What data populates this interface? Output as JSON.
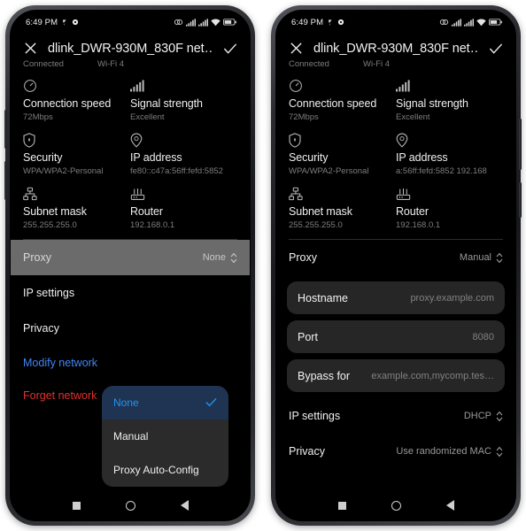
{
  "colors": {
    "screen_bg": "#000000",
    "accent_blue": "#4285f4",
    "link_red": "#e0322c",
    "dropdown_selected_bg": "#1f3352",
    "dropdown_selected_text": "#2196f3",
    "field_bg": "#262626",
    "pressed_row_bg": "#6b6b6b",
    "label_text": "#f0f0f0",
    "muted_text": "#7d7d7d"
  },
  "statusbar": {
    "time": "6:49 PM",
    "left_icons": [
      "location-off-icon",
      "gear-icon"
    ],
    "right_icons": [
      "data-saver-icon",
      "signal-bars-sim1-icon",
      "signal-bars-sim2-icon",
      "wifi-icon",
      "battery-icon"
    ]
  },
  "header": {
    "close_icon": "close-icon",
    "title": "dlink_DWR-930M_830F net…",
    "confirm_icon": "check-icon",
    "status": "Connected",
    "wifi_standard": "Wi-Fi 4"
  },
  "info_cells": [
    {
      "icon": "speedometer-icon",
      "label": "Connection speed",
      "value": "72Mbps"
    },
    {
      "icon": "signal-bars-icon",
      "label": "Signal strength",
      "value": "Excellent"
    },
    {
      "icon": "shield-lock-icon",
      "label": "Security",
      "value": "WPA/WPA2-Personal"
    },
    {
      "icon": "location-pin-icon",
      "label": "IP address",
      "value_left": "fe80::c47a:56ff:fefd:5852",
      "value_right": "a:56ff:fefd:5852 192.168"
    },
    {
      "icon": "network-topology-icon",
      "label": "Subnet mask",
      "value": "255.255.255.0"
    },
    {
      "icon": "router-icon",
      "label": "Router",
      "value": "192.168.0.1"
    }
  ],
  "left_panel": {
    "proxy_row": {
      "label": "Proxy",
      "value": "None",
      "spinner_icon": "spinner-updown-icon"
    },
    "ip_settings_row": {
      "label": "IP settings"
    },
    "privacy_row": {
      "label": "Privacy"
    },
    "modify_link": "Modify network",
    "forget_link": "Forget network",
    "dropdown": {
      "items": [
        {
          "label": "None",
          "selected": true,
          "check_icon": "check-icon"
        },
        {
          "label": "Manual",
          "selected": false
        },
        {
          "label": "Proxy Auto-Config",
          "selected": false
        }
      ]
    }
  },
  "right_panel": {
    "proxy_row": {
      "label": "Proxy",
      "value": "Manual",
      "spinner_icon": "spinner-updown-icon"
    },
    "hostname_field": {
      "label": "Hostname",
      "placeholder": "proxy.example.com"
    },
    "port_field": {
      "label": "Port",
      "placeholder": "8080"
    },
    "bypass_field": {
      "label": "Bypass for",
      "placeholder": "example.com,mycomp.tes…"
    },
    "ip_settings_row": {
      "label": "IP settings",
      "value": "DHCP",
      "spinner_icon": "spinner-updown-icon"
    },
    "privacy_row": {
      "label": "Privacy",
      "value": "Use randomized MAC",
      "spinner_icon": "spinner-updown-icon"
    }
  },
  "navbar": {
    "recents_icon": "square-recents-icon",
    "home_icon": "circle-home-icon",
    "back_icon": "triangle-back-icon"
  }
}
